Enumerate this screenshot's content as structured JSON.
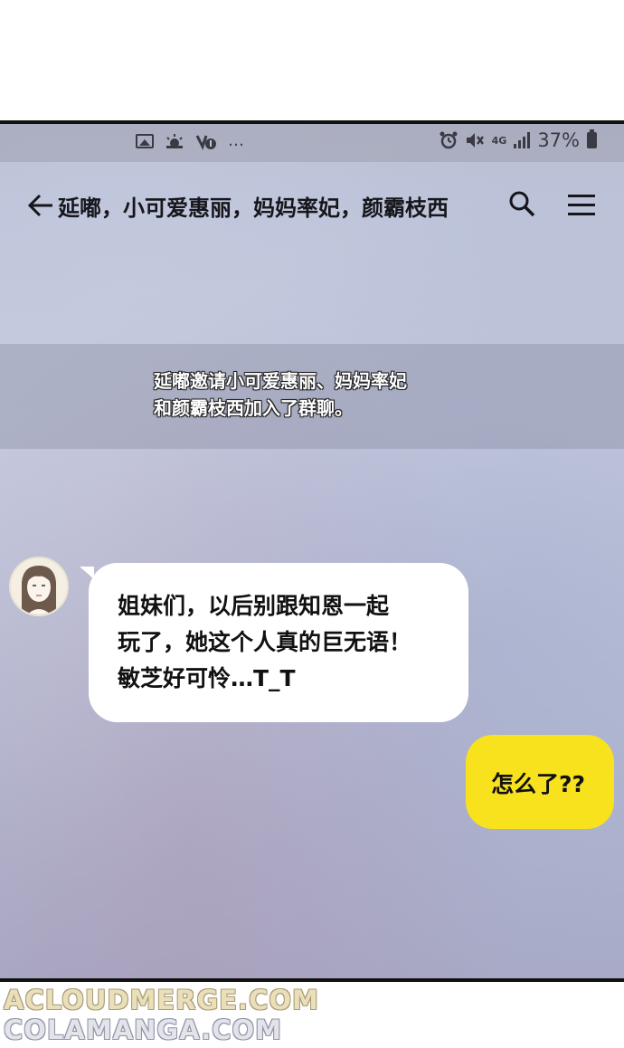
{
  "status_bar": {
    "left_icons": [
      "image-icon",
      "weather-icon",
      "missed-call-icon"
    ],
    "more": "…",
    "network": "4G",
    "battery_level": "37%"
  },
  "header": {
    "title": "延嘟，小可爱惠丽，妈妈率妃，颜霸枝西"
  },
  "system_message": {
    "line1": "延嘟邀请小可爱惠丽、妈妈率妃",
    "line2": "和颜霸枝西加入了群聊。"
  },
  "messages": [
    {
      "side": "left",
      "lines": [
        "姐妹们，以后别跟知恩一起",
        "玩了，她这个人真的巨无语！",
        "敏芝好可怜…T_T"
      ]
    },
    {
      "side": "right",
      "lines": [
        "怎么了??"
      ]
    }
  ],
  "watermarks": [
    "ACLOUDMERGE.COM",
    "COLAMANGA.COM"
  ],
  "colors": {
    "my_bubble": "#f8e11d",
    "other_bubble": "#ffffff"
  }
}
